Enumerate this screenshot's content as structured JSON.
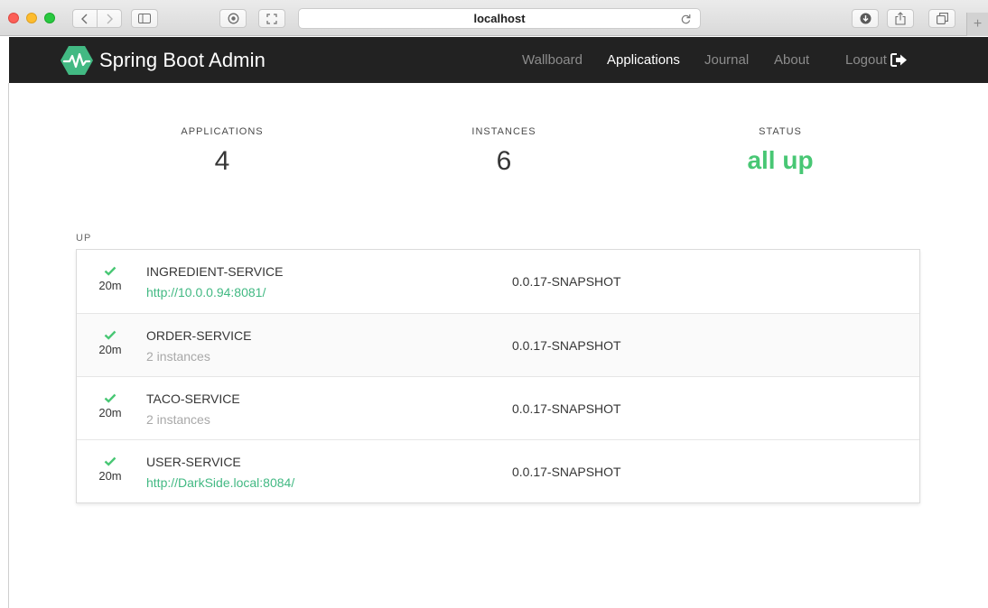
{
  "browser": {
    "url": "localhost",
    "icons": {
      "back": "chevron-left-icon",
      "forward": "chevron-right-icon",
      "sidebar": "sidebar-icon",
      "shield": "shield-icon",
      "fullscreen": "fullscreen-icon",
      "reload": "reload-icon",
      "download": "download-icon",
      "share": "share-icon",
      "tabs": "tabs-overview-icon",
      "new_tab": "plus-icon"
    }
  },
  "navbar": {
    "brand": "Spring Boot Admin",
    "links": [
      {
        "label": "Wallboard",
        "active": false
      },
      {
        "label": "Applications",
        "active": true
      },
      {
        "label": "Journal",
        "active": false
      },
      {
        "label": "About",
        "active": false
      }
    ],
    "logout_label": "Logout"
  },
  "stats": {
    "applications_label": "APPLICATIONS",
    "applications_value": "4",
    "instances_label": "INSTANCES",
    "instances_value": "6",
    "status_label": "STATUS",
    "status_value": "all up"
  },
  "group": {
    "label": "UP",
    "applications": [
      {
        "status": "UP",
        "uptime": "20m",
        "name": "INGREDIENT-SERVICE",
        "subtitle": "http://10.0.0.94:8081/",
        "subtitle_is_link": true,
        "version": "0.0.17-SNAPSHOT"
      },
      {
        "status": "UP",
        "uptime": "20m",
        "name": "ORDER-SERVICE",
        "subtitle": "2 instances",
        "subtitle_is_link": false,
        "version": "0.0.17-SNAPSHOT"
      },
      {
        "status": "UP",
        "uptime": "20m",
        "name": "TACO-SERVICE",
        "subtitle": "2 instances",
        "subtitle_is_link": false,
        "version": "0.0.17-SNAPSHOT"
      },
      {
        "status": "UP",
        "uptime": "20m",
        "name": "USER-SERVICE",
        "subtitle": "http://DarkSide.local:8084/",
        "subtitle_is_link": true,
        "version": "0.0.17-SNAPSHOT"
      }
    ]
  },
  "colors": {
    "brand_green": "#42b983",
    "status_up": "#48c774",
    "navbar_bg": "#222222"
  }
}
